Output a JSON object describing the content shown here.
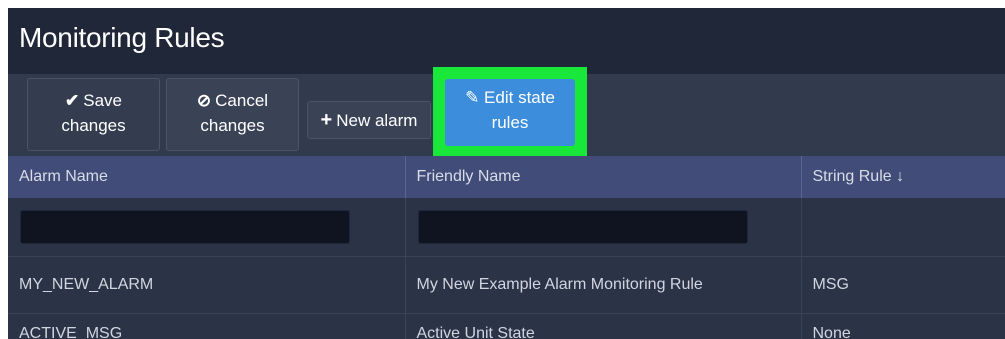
{
  "page_title": "Monitoring Rules",
  "toolbar": {
    "save": {
      "icon": "✔",
      "line1": "Save",
      "line2": "changes"
    },
    "cancel": {
      "icon": "⃠",
      "line1": "Cancel",
      "line2": "changes"
    },
    "new_alarm": {
      "icon": "+",
      "label": "New alarm"
    },
    "edit_state": {
      "icon": "✎",
      "line1": "Edit state",
      "line2": "rules"
    }
  },
  "table": {
    "columns": [
      "Alarm Name",
      "Friendly Name",
      "String Rule ↓"
    ],
    "filters": {
      "alarm_name": "",
      "friendly_name": ""
    },
    "rows": [
      {
        "alarm_name": "MY_NEW_ALARM",
        "friendly_name": "My New Example Alarm Monitoring Rule",
        "string_rule": "MSG"
      },
      {
        "alarm_name": "ACTIVE_MSG",
        "friendly_name": "Active Unit State",
        "string_rule": "None"
      }
    ]
  },
  "colors": {
    "highlight": "#19e83a",
    "primary_button": "#3c8edc",
    "header_bg": "#414c78"
  }
}
